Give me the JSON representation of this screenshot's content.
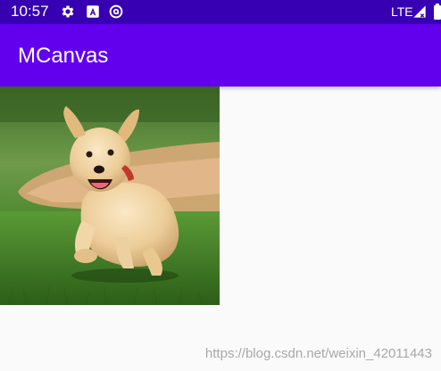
{
  "status_bar": {
    "time": "10:57",
    "network": "LTE",
    "background": "#3700b3",
    "icons": [
      "gear-icon",
      "a-box-icon",
      "at-sync-icon",
      "signal-icon",
      "battery-icon"
    ]
  },
  "app_bar": {
    "title": "MCanvas",
    "background": "#6200ee"
  },
  "canvas": {
    "image": "puppy-running-on-grass"
  },
  "watermark": {
    "text": "https://blog.csdn.net/weixin_42011443"
  }
}
